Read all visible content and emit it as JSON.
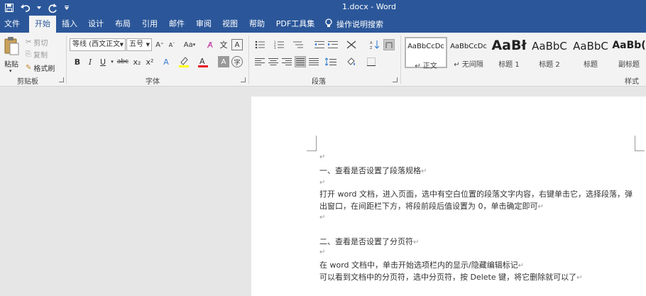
{
  "window": {
    "title": "1.docx  -  Word"
  },
  "qat": [
    {
      "name": "save-icon"
    },
    {
      "name": "undo-icon"
    },
    {
      "name": "redo-icon"
    },
    {
      "name": "customize-qat-icon"
    }
  ],
  "tabs": [
    "文件",
    "开始",
    "插入",
    "设计",
    "布局",
    "引用",
    "邮件",
    "审阅",
    "视图",
    "帮助",
    "PDF工具集"
  ],
  "tell_me": "操作说明搜索",
  "clipboard": {
    "paste": "粘贴",
    "cut": "剪切",
    "copy": "复制",
    "format_painter": "格式刷",
    "label": "剪贴板"
  },
  "font": {
    "name": "等线 (西文正文",
    "size": "五号",
    "grow": "A",
    "shrink": "A",
    "change_case": "Aa",
    "bold": "B",
    "italic": "I",
    "underline": "U",
    "strike": "abc",
    "subscript": "x₂",
    "superscript": "x²",
    "label": "字体",
    "colors": {
      "highlight": "#ffff00",
      "font_color": "#e81123"
    }
  },
  "paragraph": {
    "label": "段落"
  },
  "styles": {
    "label": "样式",
    "items": [
      {
        "sample": "AaBbCcDc",
        "name": "↵ 正文"
      },
      {
        "sample": "AaBbCcDc",
        "name": "↵ 无间隔"
      },
      {
        "sample": "AaBł",
        "name": "标题 1"
      },
      {
        "sample": "AaBbC",
        "name": "标题 2"
      },
      {
        "sample": "AaBbC",
        "name": "标题"
      },
      {
        "sample": "AaBb(",
        "name": "副标题"
      }
    ]
  },
  "document": {
    "pilcrow": "↵",
    "lines": [
      "一、查看是否设置了段落规格",
      "打开 word 文档，进入页面，选中有空白位置的段落文字内容，右键单击它，选择段落，弹",
      "出窗口，在间距栏下方，将段前段后值设置为 0，单击确定即可",
      "二、查看是否设置了分页符",
      "在 word 文档中，单击开始选项栏内的显示/隐藏编辑标记",
      "可以看到文档中的分页符，选中分页符，按 Delete 键，将它删除就可以了"
    ]
  },
  "theme": {
    "accent": "#2b579a",
    "ribbon_bg": "#f3f3f3",
    "canvas_bg": "#e6e6e6"
  }
}
